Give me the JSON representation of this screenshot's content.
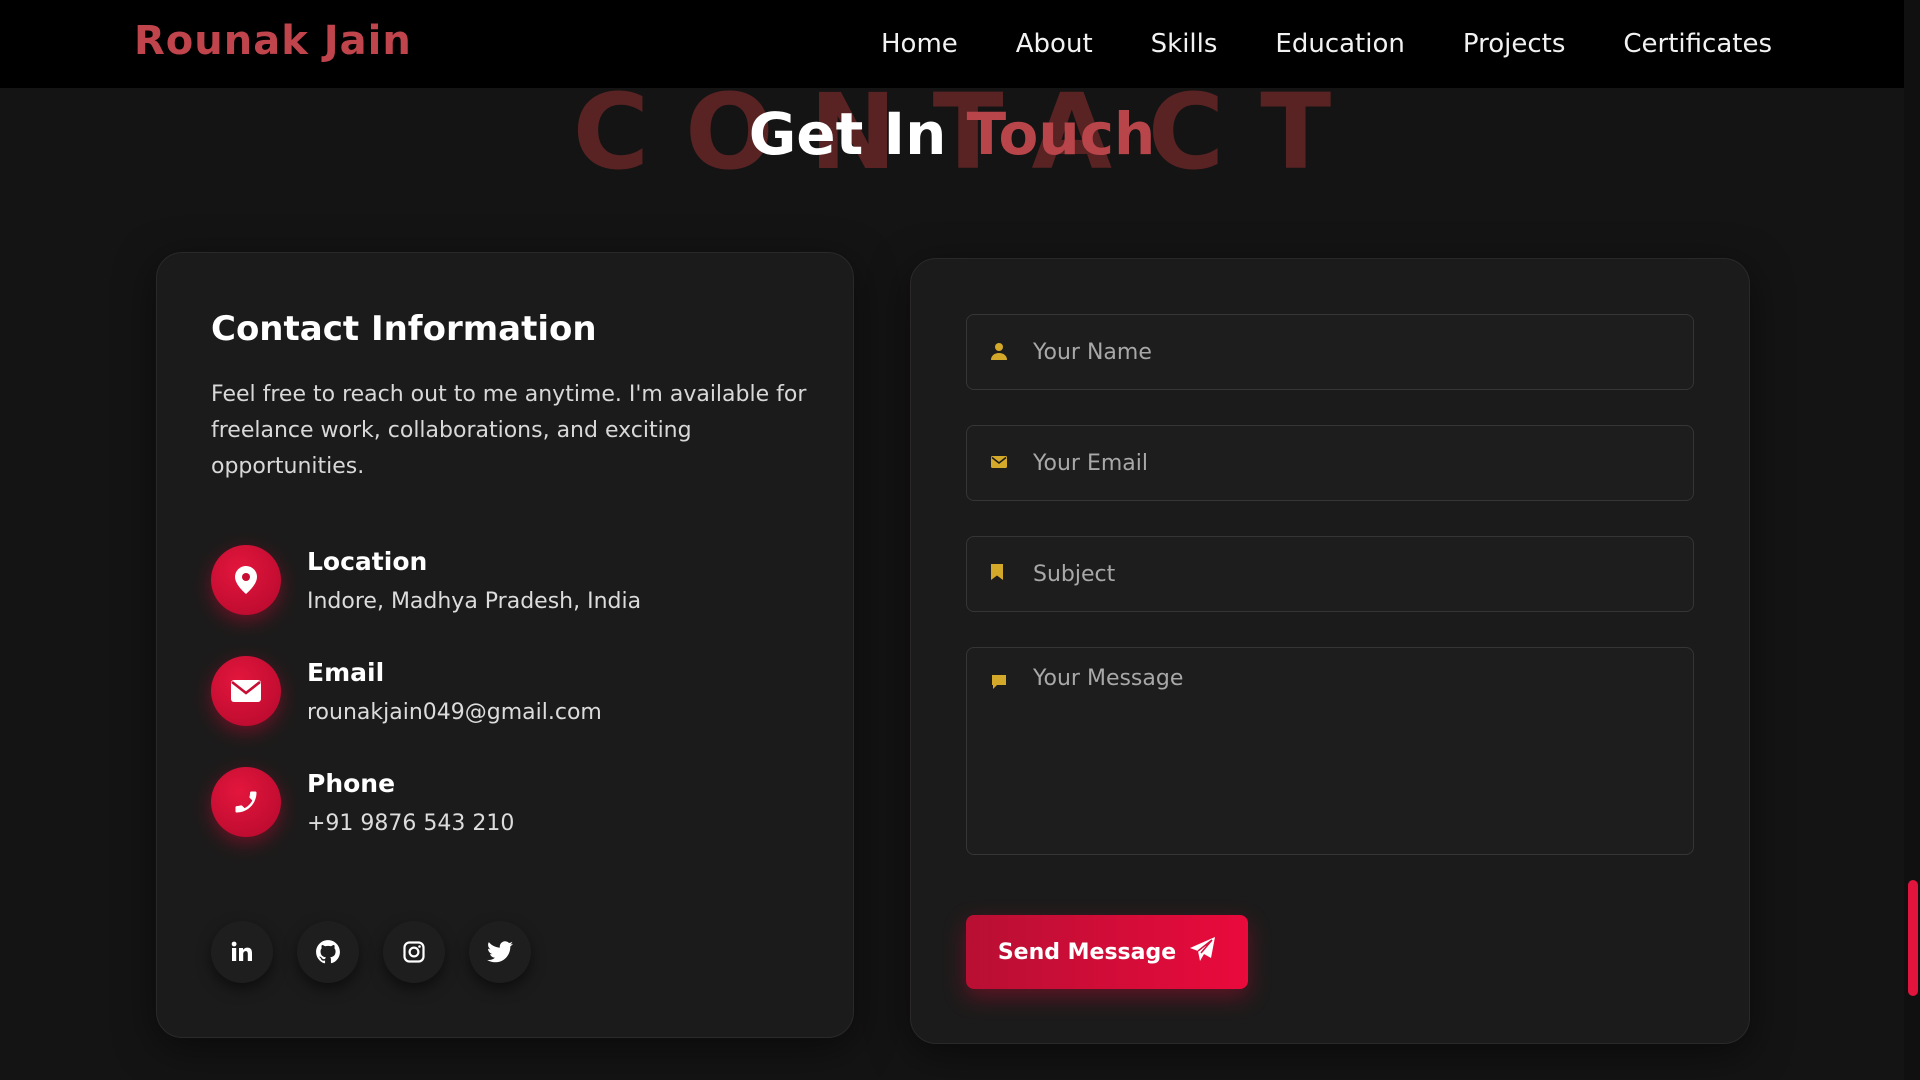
{
  "nav": {
    "brand": "Rounak Jain",
    "links": [
      "Home",
      "About",
      "Skills",
      "Education",
      "Projects",
      "Certificates"
    ]
  },
  "section": {
    "bg_word": "CONTACT",
    "title_main": "Get In",
    "title_accent": "Touch"
  },
  "info": {
    "title": "Contact Information",
    "description": "Feel free to reach out to me anytime. I'm available for freelance work, collaborations, and exciting opportunities.",
    "items": [
      {
        "label": "Location",
        "value": "Indore, Madhya Pradesh, India",
        "icon": "map-pin-icon"
      },
      {
        "label": "Email",
        "value": "rounakjain049@gmail.com",
        "icon": "envelope-icon"
      },
      {
        "label": "Phone",
        "value": "+91 9876 543 210",
        "icon": "phone-icon"
      }
    ],
    "socials": [
      "linkedin-icon",
      "github-icon",
      "instagram-icon",
      "twitter-icon"
    ]
  },
  "form": {
    "name_placeholder": "Your Name",
    "email_placeholder": "Your Email",
    "subject_placeholder": "Subject",
    "message_placeholder": "Your Message",
    "submit_label": "Send Message"
  },
  "colors": {
    "accent": "#e0143c",
    "brand": "#c0444c",
    "field_icon": "#d4a92a"
  }
}
